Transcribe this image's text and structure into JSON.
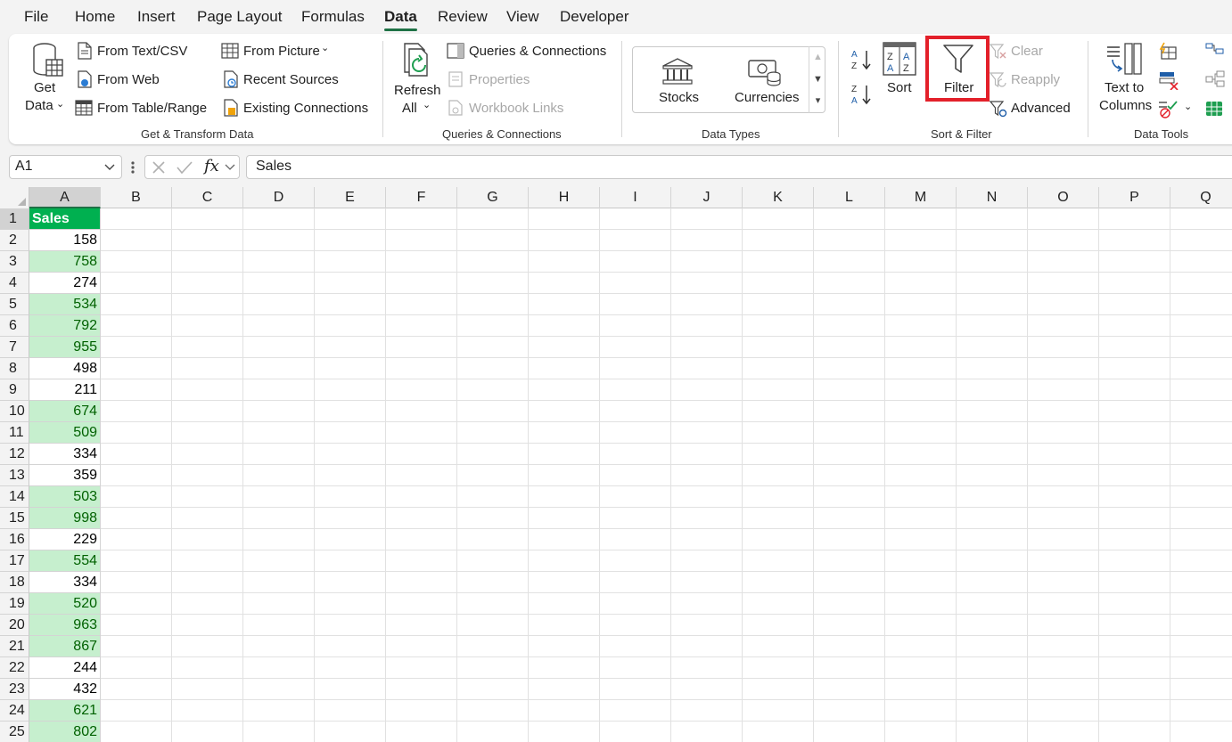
{
  "menu": {
    "file": "File",
    "home": "Home",
    "insert": "Insert",
    "page_layout": "Page Layout",
    "formulas": "Formulas",
    "data": "Data",
    "review": "Review",
    "view": "View",
    "developer": "Developer"
  },
  "ribbon": {
    "get_transform": {
      "get_data_line1": "Get",
      "get_data_line2": "Data",
      "from_text_csv": "From Text/CSV",
      "from_web": "From Web",
      "from_table_range": "From Table/Range",
      "from_picture": "From Picture",
      "recent_sources": "Recent Sources",
      "existing_connections": "Existing Connections",
      "group_label": "Get & Transform Data"
    },
    "queries": {
      "refresh_line1": "Refresh",
      "refresh_line2": "All",
      "queries_connections": "Queries & Connections",
      "properties": "Properties",
      "workbook_links": "Workbook Links",
      "group_label": "Queries & Connections"
    },
    "data_types": {
      "stocks": "Stocks",
      "currencies": "Currencies",
      "group_label": "Data Types"
    },
    "sort_filter": {
      "sort": "Sort",
      "filter": "Filter",
      "clear": "Clear",
      "reapply": "Reapply",
      "advanced": "Advanced",
      "group_label": "Sort & Filter"
    },
    "data_tools": {
      "text_to_line1": "Text to",
      "text_to_line2": "Columns",
      "group_label": "Data Tools"
    }
  },
  "formula_bar": {
    "name_box": "A1",
    "fx": "fx",
    "content": "Sales"
  },
  "sheet": {
    "columns": [
      "A",
      "B",
      "C",
      "D",
      "E",
      "F",
      "G",
      "H",
      "I",
      "J",
      "K",
      "L",
      "M",
      "N",
      "O",
      "P",
      "Q"
    ],
    "header": "Sales",
    "values": [
      158,
      758,
      274,
      534,
      792,
      955,
      498,
      211,
      674,
      509,
      334,
      359,
      503,
      998,
      229,
      554,
      334,
      520,
      963,
      867,
      244,
      432,
      621,
      802
    ],
    "highlight_color": "#c6efce",
    "highlight_text_color": "#006100",
    "header_fill": "#00b050"
  },
  "colors": {
    "accent": "#1e7145",
    "highlight_box": "#e3202a"
  }
}
